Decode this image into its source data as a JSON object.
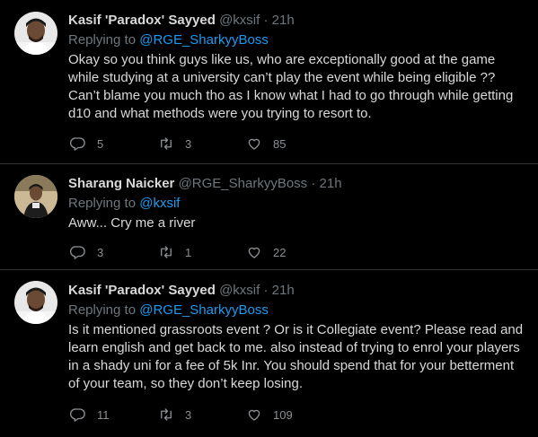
{
  "tweets": [
    {
      "name": "Kasif 'Paradox' Sayyed",
      "handle": "@kxsif",
      "dot": "·",
      "time": "21h",
      "replying_prefix": "Replying to ",
      "replying_to": "@RGE_SharkyyBoss",
      "body": "Okay so you think guys like us, who are exceptionally good at the game while studying at a university can’t play the event while being eligible ?? Can’t blame you much tho as I know what I had to go through while getting d10 and what methods were you trying to resort to.",
      "replies": "5",
      "retweets": "3",
      "likes": "85"
    },
    {
      "name": "Sharang Naicker",
      "handle": "@RGE_SharkyyBoss",
      "dot": "·",
      "time": "21h",
      "replying_prefix": "Replying to ",
      "replying_to": "@kxsif",
      "body": "Aww... Cry me a river",
      "replies": "3",
      "retweets": "1",
      "likes": "22"
    },
    {
      "name": "Kasif 'Paradox' Sayyed",
      "handle": "@kxsif",
      "dot": "·",
      "time": "21h",
      "replying_prefix": "Replying to ",
      "replying_to": "@RGE_SharkyyBoss",
      "body": "Is it mentioned grassroots event ? Or is it Collegiate event? Please read and learn english and get back to me. also instead of trying to enrol your players in a shady uni for a fee of 5k Inr. You should spend that for your betterment of your team, so they don’t keep losing.",
      "replies": "11",
      "retweets": "3",
      "likes": "109"
    }
  ],
  "colors": {
    "background": "#000000",
    "text": "#d9d9d9",
    "muted": "#6e767d",
    "link": "#1d9bf0",
    "divider": "#2f3336"
  },
  "icons": {
    "reply": "reply-icon",
    "retweet": "retweet-icon",
    "like": "heart-icon"
  }
}
